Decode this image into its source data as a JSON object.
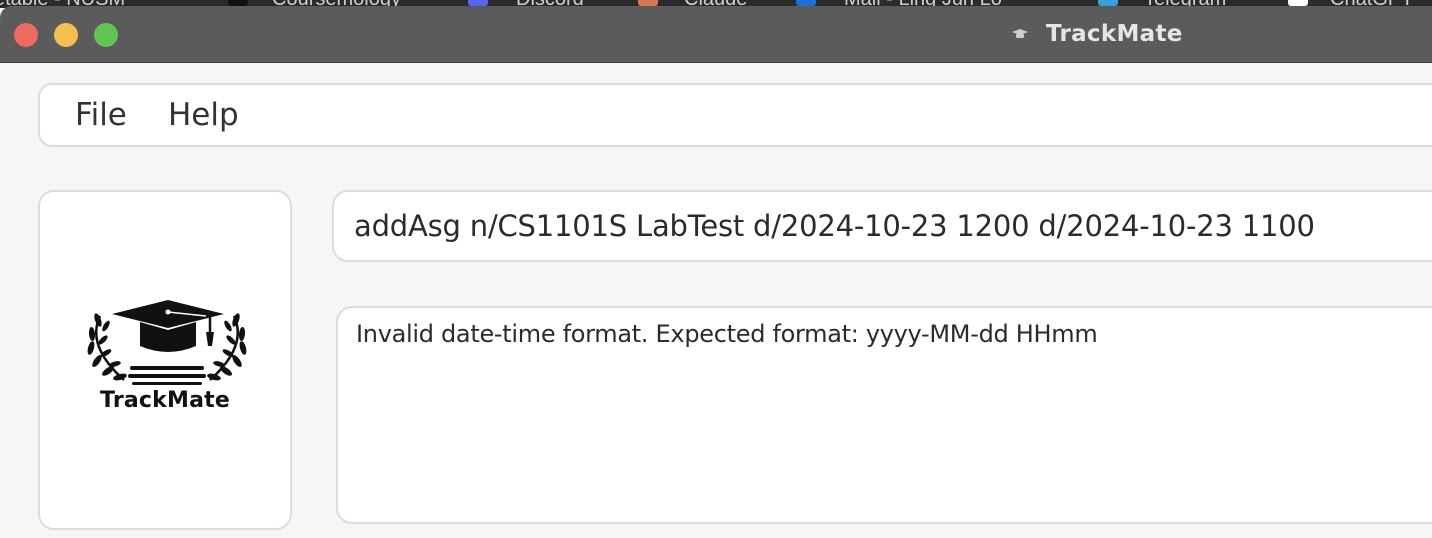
{
  "window": {
    "title": "TrackMate",
    "app_icon": "trackmate-app-icon"
  },
  "background_tabs": [
    {
      "label": "etable - NUSM",
      "icon": "tab-icon"
    },
    {
      "label": "Coursemology",
      "icon": "coursemology-icon"
    },
    {
      "label": "Discord",
      "icon": "discord-icon"
    },
    {
      "label": "Claude",
      "icon": "claude-icon"
    },
    {
      "label": "Mail - Ling Jun Lo",
      "icon": "outlook-icon"
    },
    {
      "label": "Telegram",
      "icon": "telegram-icon"
    },
    {
      "label": "ChatGPT",
      "icon": "chatgpt-icon"
    }
  ],
  "menu": {
    "file_label": "File",
    "help_label": "Help"
  },
  "logo": {
    "text": "TrackMate",
    "icon": "graduation-cap-laurel-icon"
  },
  "command": {
    "value": "addAsg n/CS1101S LabTest d/2024-10-23 1200 d/2024-10-23 1100"
  },
  "result": {
    "message": "Invalid date-time format. Expected format: yyyy-MM-dd HHmm"
  },
  "colors": {
    "titlebar": "#5b5b5b",
    "close": "#ed6a5e",
    "minimize": "#f5bf4f",
    "maximize": "#61c554",
    "panel_border": "#dcdcdc"
  }
}
